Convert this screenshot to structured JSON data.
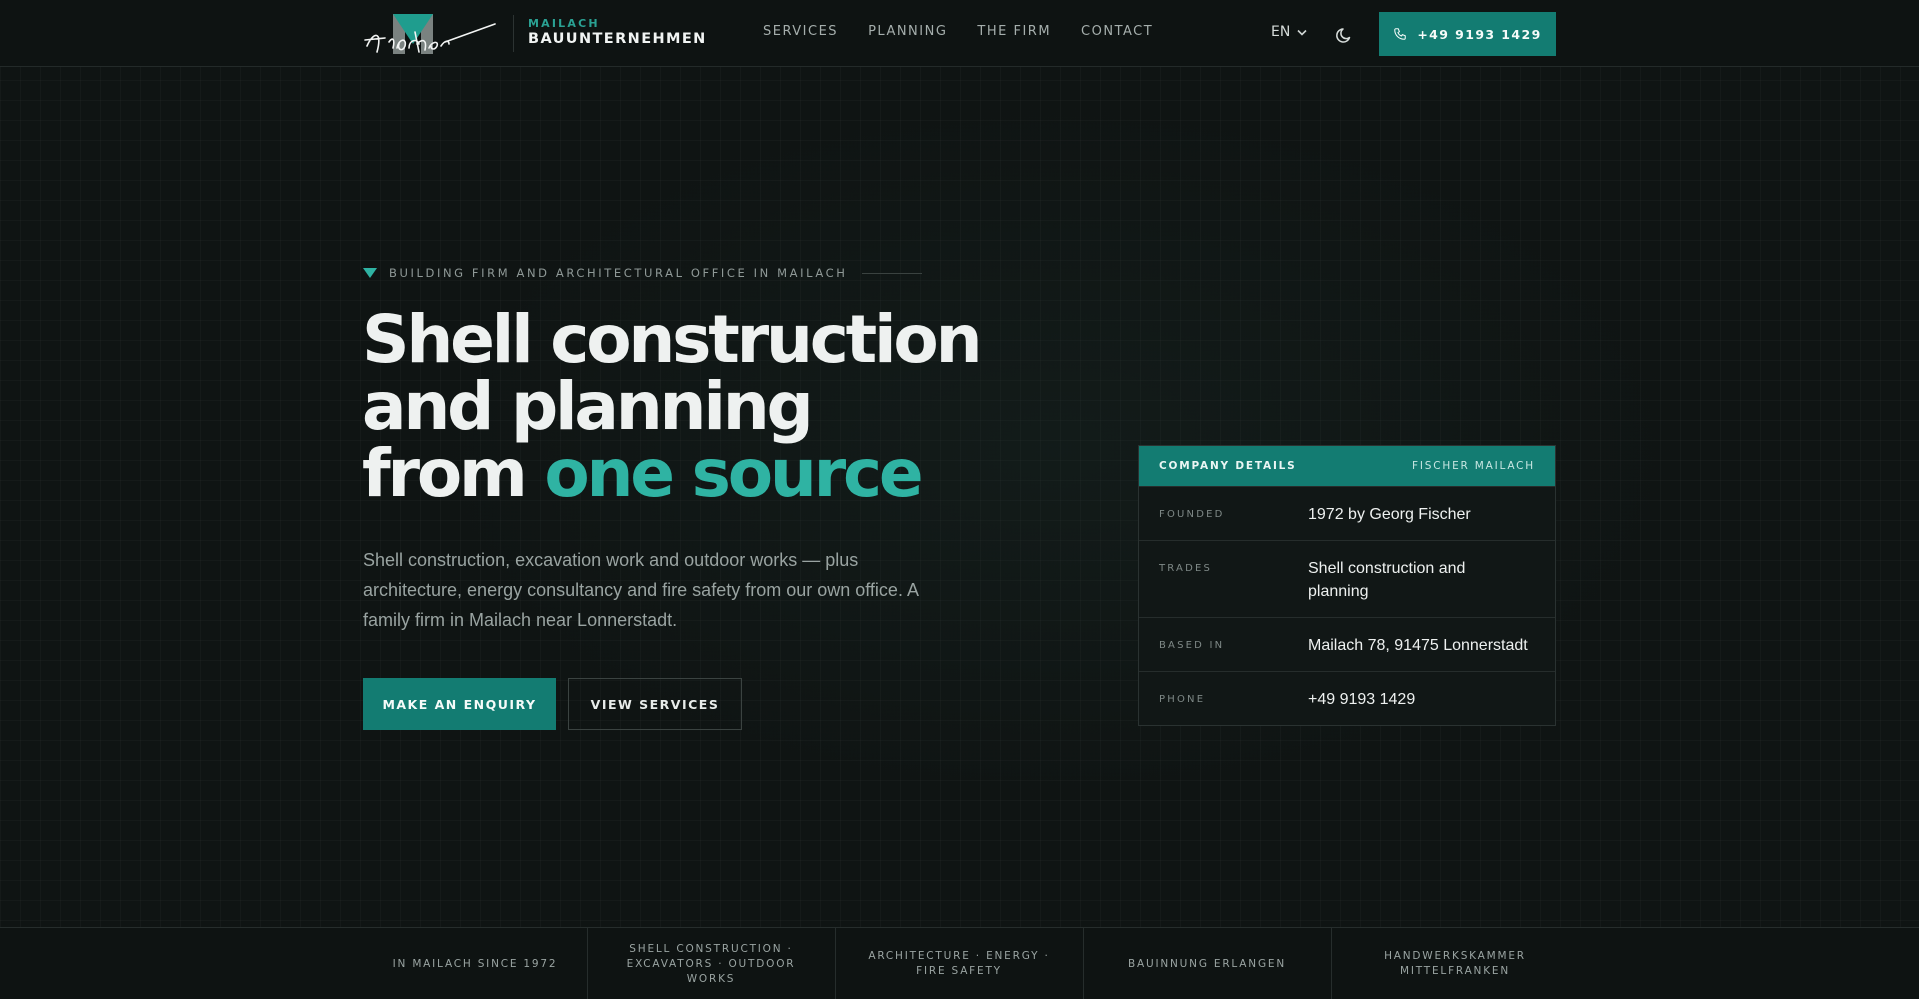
{
  "header": {
    "logo_script": "Fischer",
    "logo_kicker": "MAILACH",
    "logo_name": "BAUUNTERNEHMEN",
    "nav": [
      "SERVICES",
      "PLANNING",
      "THE FIRM",
      "CONTACT"
    ],
    "language": "EN",
    "phone": "+49 9193 1429",
    "icons": {
      "language_dropdown": "chevron-down-icon",
      "theme": "moon-icon",
      "phone": "phone-icon"
    }
  },
  "hero": {
    "eyebrow": "BUILDING FIRM AND ARCHITECTURAL OFFICE IN MAILACH",
    "headline_line1": "Shell construction",
    "headline_line2": "and planning",
    "headline_line3_prefix": "from ",
    "headline_line3_accent": "one source",
    "lead": "Shell construction, excavation work and outdoor works — plus architecture, energy consultancy and fire safety from our own office. A family firm in Mailach near Lonnerstadt.",
    "primary_cta": "MAKE AN ENQUIRY",
    "secondary_cta": "VIEW SERVICES"
  },
  "company_card": {
    "title": "COMPANY DETAILS",
    "subtitle": "FISCHER MAILACH",
    "rows": [
      {
        "label": "FOUNDED",
        "value": "1972 by Georg Fischer"
      },
      {
        "label": "TRADES",
        "value": "Shell construction and planning"
      },
      {
        "label": "BASED IN",
        "value": "Mailach 78, 91475 Lonnerstadt"
      },
      {
        "label": "PHONE",
        "value": "+49 9193 1429"
      }
    ]
  },
  "strip": [
    "IN MAILACH SINCE 1972",
    "SHELL CONSTRUCTION · EXCAVATORS · OUTDOOR WORKS",
    "ARCHITECTURE · ENERGY · FIRE SAFETY",
    "BAUINNUNG ERLANGEN",
    "HANDWERKSKAMMER MITTELFRANKEN"
  ],
  "colors": {
    "accent": "#137c72",
    "accent_text": "#2fb3a3",
    "background": "#0f1413"
  }
}
